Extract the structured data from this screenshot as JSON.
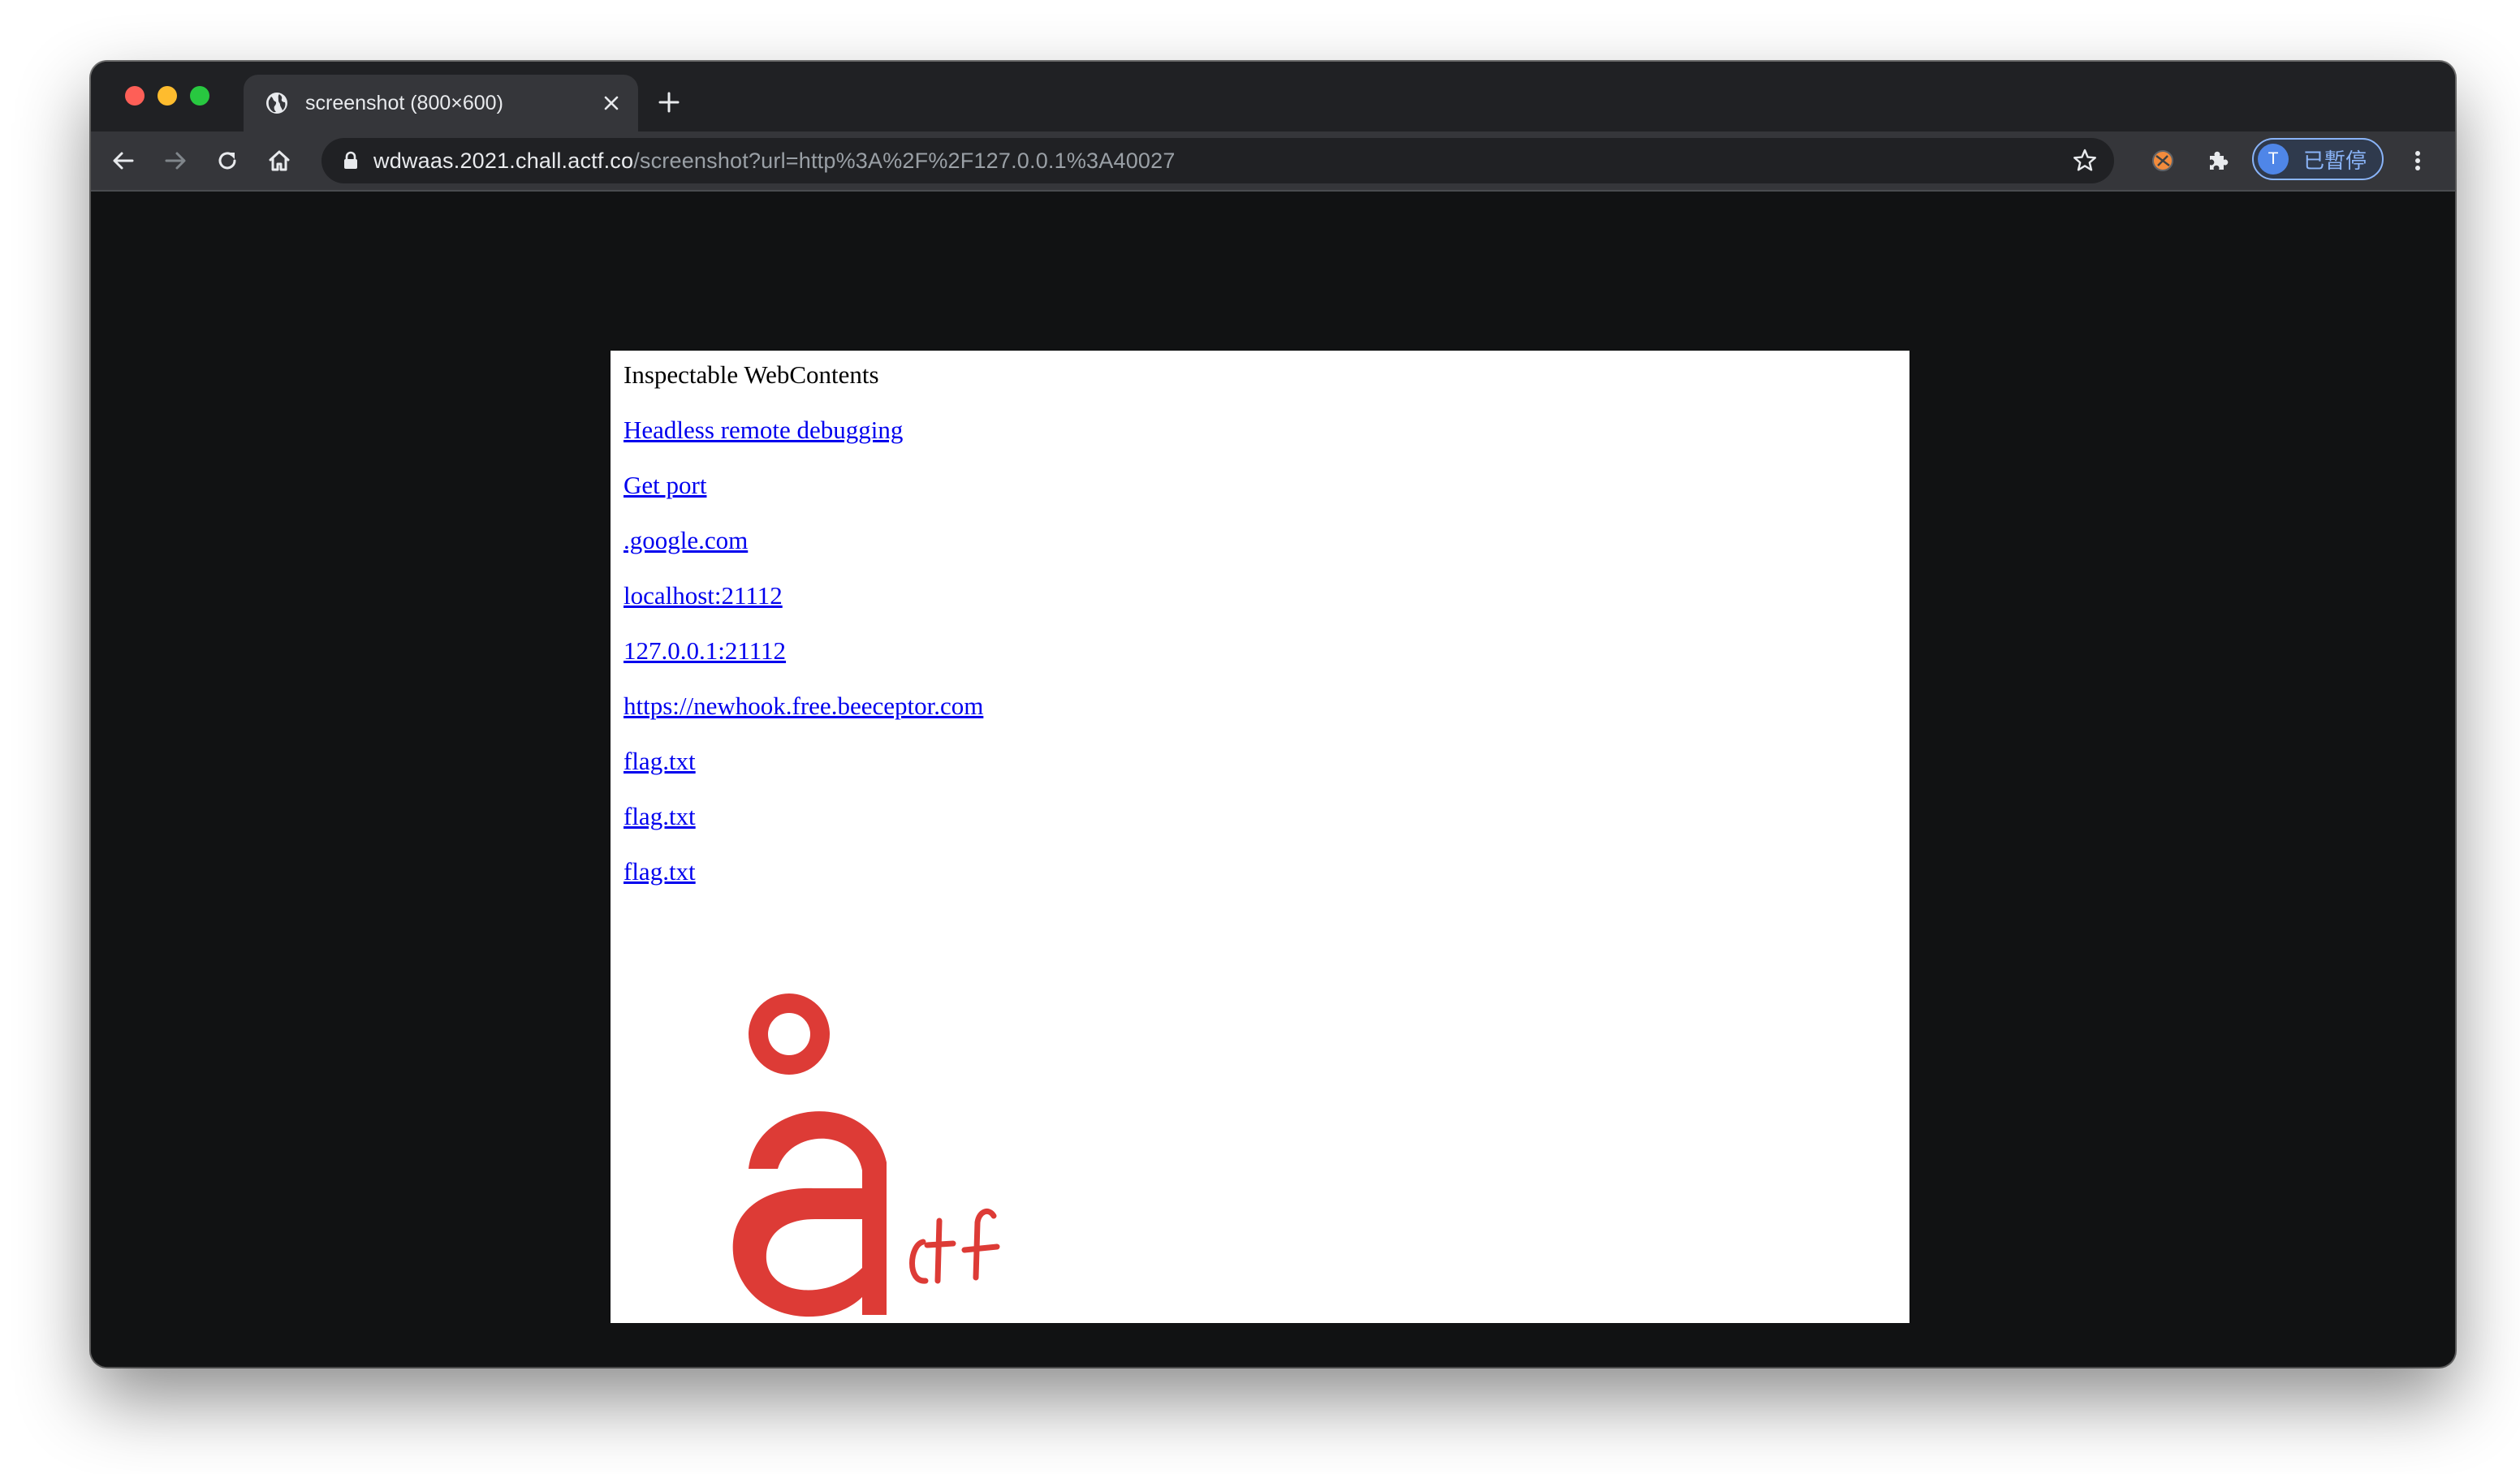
{
  "window": {
    "tab_title": "screenshot (800×600)"
  },
  "toolbar": {
    "url_host": "wdwaas.2021.chall.actf.co",
    "url_path": "/screenshot?url=http%3A%2F%2F127.0.0.1%3A40027",
    "profile_initial": "T",
    "profile_label": "已暫停"
  },
  "icons": {
    "favicon": "globe-icon",
    "tab_close": "close-icon",
    "new_tab": "plus-icon",
    "back": "arrow-left-icon",
    "forward": "arrow-right-icon",
    "reload": "reload-icon",
    "home": "home-icon",
    "lock": "lock-icon",
    "bookmark": "star-icon",
    "extension_1": "extension-badge-icon",
    "extensions": "puzzle-icon",
    "menu": "kebab-menu-icon"
  },
  "page": {
    "heading": "Inspectable WebContents",
    "links": [
      "Headless remote debugging",
      "Get port",
      ".google.com",
      "localhost:21112",
      "127.0.0.1:21112",
      "https://newhook.free.beeceptor.com",
      "flag.txt",
      "flag.txt",
      "flag.txt"
    ],
    "logo_text": "actf"
  },
  "colors": {
    "chrome_dark": "#202124",
    "toolbar": "#35363a",
    "link": "#0000ee",
    "logo_red": "#dd3b36",
    "profile_accent": "#8ab4f8"
  }
}
